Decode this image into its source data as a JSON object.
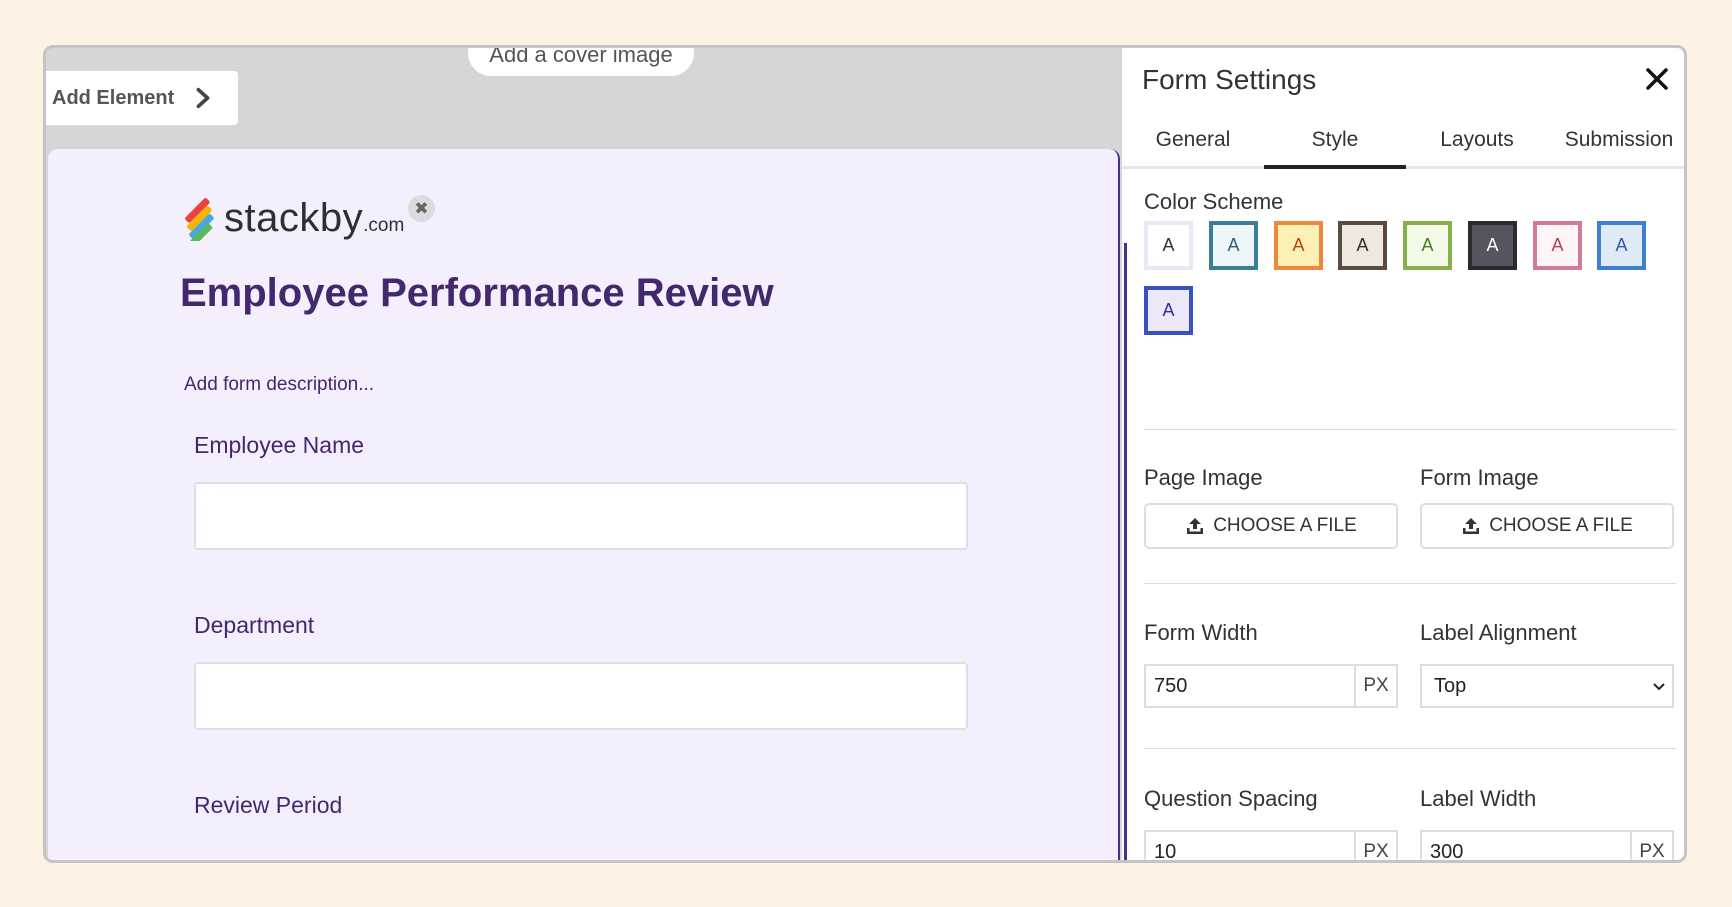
{
  "canvas": {
    "add_element_label": "Add Element",
    "cover_image_label": "Add a cover image"
  },
  "form": {
    "logo_text": "stackby",
    "logo_suffix": ".com",
    "title": "Employee Performance Review",
    "description_placeholder": "Add form description...",
    "fields": [
      {
        "label": "Employee Name"
      },
      {
        "label": "Department"
      },
      {
        "label": "Review Period"
      }
    ]
  },
  "panel": {
    "title": "Form Settings",
    "tabs": [
      {
        "label": "General"
      },
      {
        "label": "Style"
      },
      {
        "label": "Layouts"
      },
      {
        "label": "Submission"
      }
    ],
    "active_tab": "Style",
    "color_scheme": {
      "label": "Color Scheme",
      "swatches": [
        {
          "letter": "A",
          "border": "#e6eaf6",
          "bg": "#ffffff",
          "text": "#333333"
        },
        {
          "letter": "A",
          "border": "#3b7e9c",
          "bg": "#eef6fa",
          "text": "#2b5f7a"
        },
        {
          "letter": "A",
          "border": "#f0873a",
          "bg": "#fdf0b4",
          "text": "#b04a10"
        },
        {
          "letter": "A",
          "border": "#5a4b3e",
          "bg": "#efe8dc",
          "text": "#3a2e24"
        },
        {
          "letter": "A",
          "border": "#86b04a",
          "bg": "#f4f9e8",
          "text": "#4c7a20"
        },
        {
          "letter": "A",
          "border": "#2a2a30",
          "bg": "#555560",
          "text": "#ffffff"
        },
        {
          "letter": "A",
          "border": "#d47a96",
          "bg": "#fdf4f6",
          "text": "#b0405e"
        },
        {
          "letter": "A",
          "border": "#3e7fd0",
          "bg": "#dfeaf7",
          "text": "#2a5fa8"
        },
        {
          "letter": "A",
          "border": "#3a4fc0",
          "bg": "#ece8fa",
          "text": "#3a2d8c"
        }
      ]
    },
    "page_image": {
      "label": "Page Image",
      "button": "CHOOSE A FILE"
    },
    "form_image": {
      "label": "Form Image",
      "button": "CHOOSE A FILE"
    },
    "form_width": {
      "label": "Form Width",
      "value": "750",
      "unit": "PX"
    },
    "label_alignment": {
      "label": "Label Alignment",
      "value": "Top"
    },
    "question_spacing": {
      "label": "Question Spacing",
      "value": "10",
      "unit": "PX"
    },
    "label_width": {
      "label": "Label Width",
      "value": "300",
      "unit": "PX"
    }
  },
  "icons": {
    "chevron": "chevron-right-icon",
    "close": "close-icon",
    "upload": "upload-icon",
    "caret": "chevron-down-icon"
  }
}
